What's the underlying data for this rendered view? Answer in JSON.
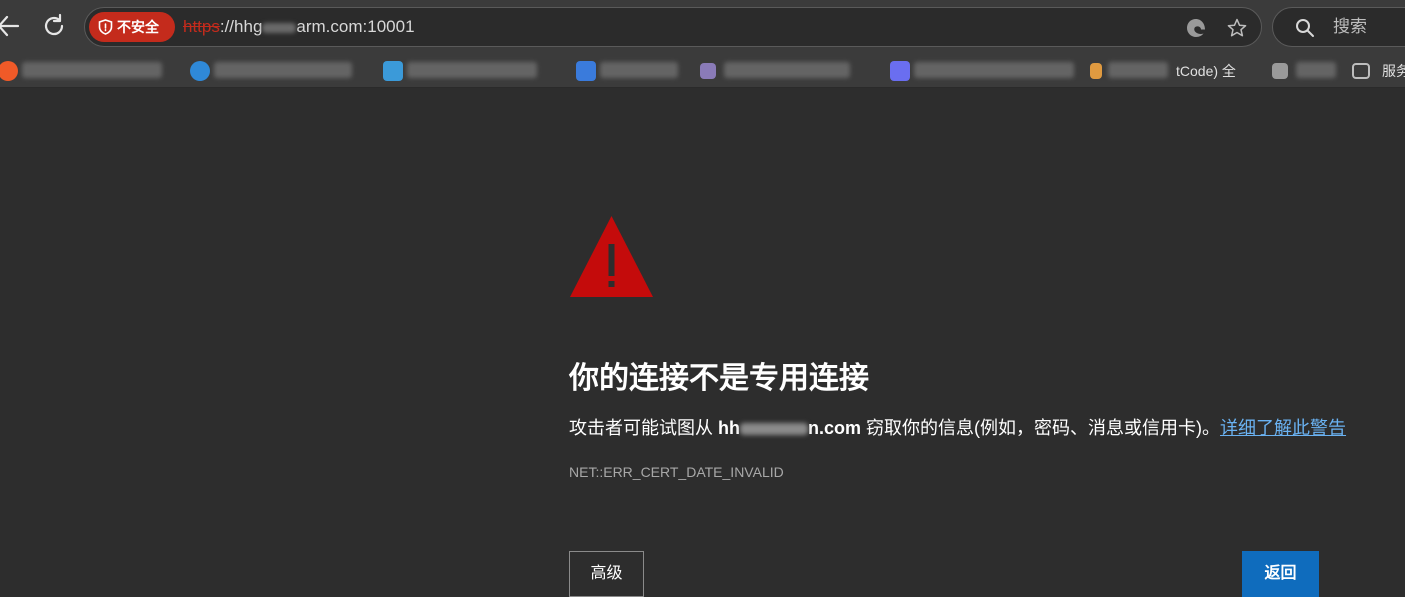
{
  "toolbar": {
    "security_label": "不安全",
    "url_scheme": "https",
    "url_sep": "://",
    "url_host_start": "hhg",
    "url_host_end": "arm.com:10001",
    "search_placeholder": "搜索"
  },
  "bookmarks": [
    {
      "id": "bm1",
      "fav_color": "#f05a28"
    },
    {
      "id": "bm2",
      "fav_color": "#2f89d8"
    },
    {
      "id": "bm3",
      "fav_color": "#3b9ad9"
    },
    {
      "id": "bm4",
      "fav_color": "#3a7bdc"
    },
    {
      "id": "bm5",
      "fav_color": "#8a7bb8"
    },
    {
      "id": "bm6",
      "fav_color": "#6a6ef0"
    },
    {
      "id": "bm7",
      "fav_color": "#e09a40",
      "text": "tCode) 全"
    },
    {
      "id": "bm8",
      "fav_color": "#9a9a9a"
    },
    {
      "id": "bm9",
      "fav_color": "#bdbdbd",
      "text": "服务"
    }
  ],
  "error": {
    "title": "你的连接不是专用连接",
    "desc_before": "攻击者可能试图从 ",
    "host_start": "hh",
    "host_end": "n.com",
    "desc_after": " 窃取你的信息(例如，密码、消息或信用卡)。",
    "details_link": "详细了解此警告",
    "code": "NET::ERR_CERT_DATE_INVALID",
    "advanced_button": "高级",
    "back_button": "返回"
  },
  "colors": {
    "page_bg": "#2d2d2d",
    "warning_red": "#c42b1c",
    "primary_blue": "#0f6cbd",
    "link_blue": "#6ab2f2"
  }
}
